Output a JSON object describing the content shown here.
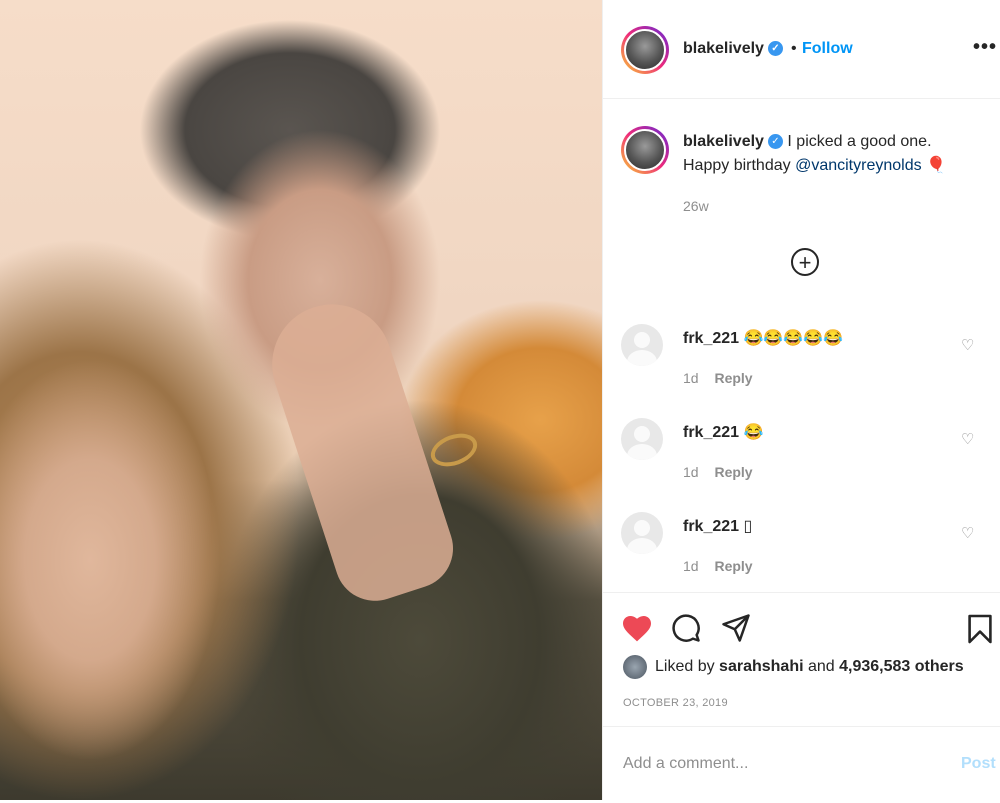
{
  "header": {
    "username": "blakelively",
    "dot": "•",
    "follow_label": "Follow",
    "more_label": "•••"
  },
  "caption": {
    "username": "blakelively",
    "text": "I picked a good one.",
    "text_line2": "Happy birthday",
    "mention": "@vancityreynolds",
    "emoji": "🎈",
    "time": "26w"
  },
  "add_comments_label": "+",
  "comments": [
    {
      "user": "frk_221",
      "text": "😂😂😂😂😂",
      "time": "1d",
      "reply": "Reply"
    },
    {
      "user": "frk_221",
      "text": "😂",
      "time": "1d",
      "reply": "Reply"
    },
    {
      "user": "frk_221",
      "text": "▯",
      "time": "1d",
      "reply": "Reply"
    }
  ],
  "likes": {
    "prefix": "Liked by",
    "user": "sarahshahi",
    "and": "and",
    "count": "4,936,583 others"
  },
  "date": "OCTOBER 23, 2019",
  "add_comment": {
    "placeholder": "Add a comment...",
    "post_label": "Post"
  },
  "colors": {
    "heart": "#ed4956",
    "follow": "#0095f6",
    "post_disabled": "#b2dffc"
  }
}
